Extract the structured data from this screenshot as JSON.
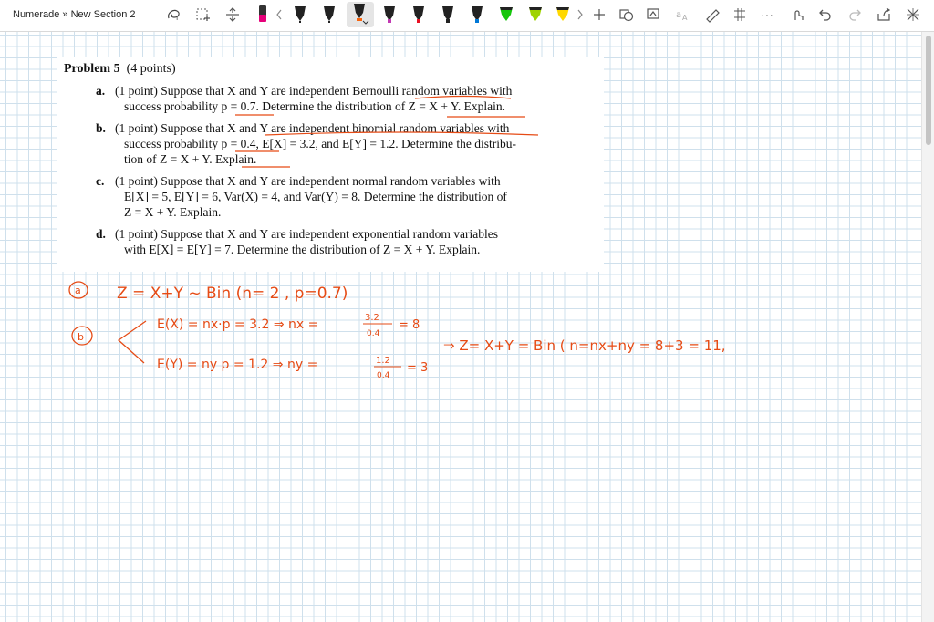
{
  "app": {
    "breadcrumb": "Numerade » New Section 2"
  },
  "toolbar": {
    "tools": [
      "lasso-select-icon",
      "add-space-icon",
      "insert-space-icon",
      "eraser-tool-icon"
    ],
    "pens": [
      {
        "name": "pen-black",
        "color": "#222222"
      },
      {
        "name": "pen-black-2",
        "color": "#222222"
      },
      {
        "name": "pen-black-3",
        "color": "#222222"
      },
      {
        "name": "pen-orange",
        "color": "#f7630c"
      },
      {
        "name": "pen-magenta",
        "color": "#c239b3"
      },
      {
        "name": "pen-red",
        "color": "#e81123"
      },
      {
        "name": "pen-blue",
        "color": "#0078d7"
      },
      {
        "name": "pen-green",
        "color": "#16c60c"
      },
      {
        "name": "pen-lime",
        "color": "#9fd300"
      },
      {
        "name": "pen-yellow",
        "color": "#ffd800"
      },
      {
        "name": "pen-cyan",
        "color": "#00b7c3"
      }
    ],
    "right_tools": [
      "add-pen-icon",
      "shape-icon",
      "ink-to-shape-icon",
      "ink-to-text-icon",
      "ruler-icon",
      "math-icon",
      "more-icon",
      "touch-draw-icon",
      "undo-icon",
      "redo-icon",
      "share-icon",
      "close-icon"
    ],
    "more_label": "···"
  },
  "problem": {
    "title_bold": "Problem 5",
    "title_points": "(4 points)",
    "parts": [
      {
        "letter": "a.",
        "lines": [
          "(1 point) Suppose that X and Y are independent Bernoulli random variables with",
          "success probability p = 0.7. Determine the distribution of Z = X + Y. Explain."
        ]
      },
      {
        "letter": "b.",
        "lines": [
          "(1 point) Suppose that X and Y are independent binomial random variables with",
          "success probability p = 0.4, E[X] = 3.2, and E[Y] = 1.2. Determine the distribu-",
          "tion of Z = X + Y. Explain."
        ]
      },
      {
        "letter": "c.",
        "lines": [
          "(1 point) Suppose that X and Y are independent normal random variables with",
          "E[X] = 5, E[Y] = 6, Var(X) = 4, and Var(Y) = 8. Determine the distribution of",
          "Z = X + Y. Explain."
        ]
      },
      {
        "letter": "d.",
        "lines": [
          "(1 point) Suppose that X and Y are independent exponential random variables",
          "with E[X] = E[Y] = 7. Determine the distribution of Z = X + Y. Explain."
        ]
      }
    ]
  },
  "ink": {
    "color": "#e64b15",
    "label_a": "a",
    "line_a": "Z = X+Y ~ Bin (n= 2 , p=0.7)",
    "label_b": "b",
    "line_b1": "E(X) = nx·p = 3.2  ⇒ nx =",
    "frac_b1_num": "3.2",
    "frac_b1_den": "0.4",
    "frac_b1_res": "= 8",
    "line_b2": "E(Y) = ny p = 1.2   ⇒ ny =",
    "frac_b2_num": "1.2",
    "frac_b2_den": "0.4",
    "frac_b2_res": "= 3",
    "line_b3": "⇒ Z= X+Y = Bin ( n=nx+ny = 8+3 = 11,"
  }
}
